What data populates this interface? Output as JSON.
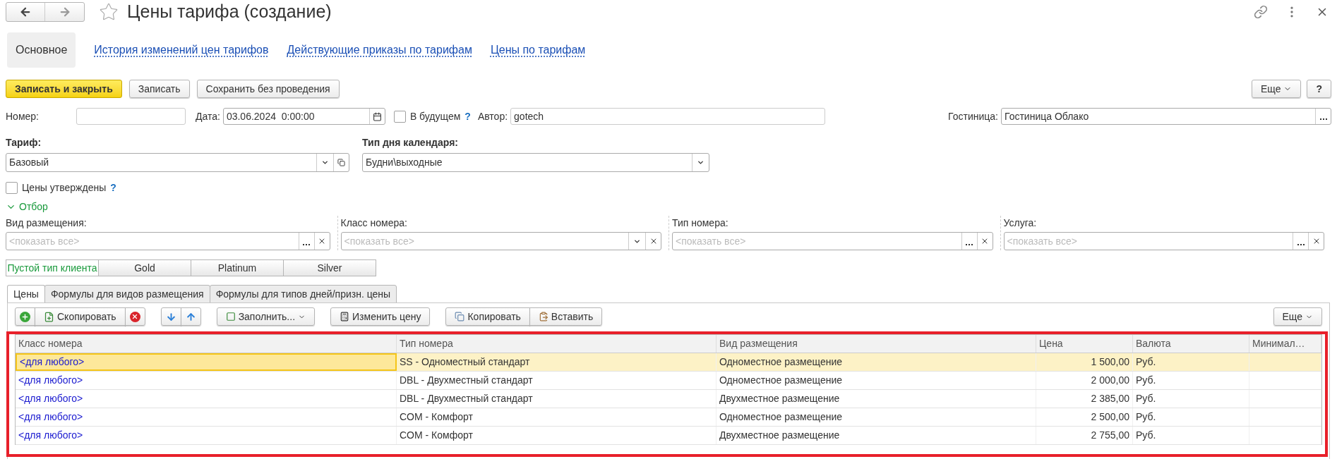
{
  "window": {
    "title": "Цены тарифа (создание)"
  },
  "nav_tabs": [
    {
      "label": "Основное",
      "selected": true
    },
    {
      "label": "История изменений цен тарифов",
      "selected": false
    },
    {
      "label": "Действующие приказы по тарифам",
      "selected": false
    },
    {
      "label": "Цены по тарифам",
      "selected": false
    }
  ],
  "command_bar": {
    "buttons": [
      {
        "label": "Записать и закрыть",
        "kind": "primary"
      },
      {
        "label": "Записать",
        "kind": "default"
      },
      {
        "label": "Сохранить без проведения",
        "kind": "default"
      }
    ],
    "more": "Еще",
    "help": "?"
  },
  "number": {
    "label": "Номер:"
  },
  "date": {
    "label": "Дата:",
    "value": "03.06.2024  0:00:00"
  },
  "in_future": {
    "label": "В будущем",
    "checked": false,
    "help": "?"
  },
  "author": {
    "label": "Автор:",
    "value": "gotech"
  },
  "hotel": {
    "label": "Гостиница:",
    "value": "Гостиница Облако"
  },
  "tariff": {
    "label": "Тариф:",
    "value": "Базовый"
  },
  "calendar_day_type": {
    "label": "Тип дня календаря:",
    "value": "Будни\\выходные"
  },
  "prices_approved": {
    "label": "Цены утверждены",
    "checked": false,
    "help": "?"
  },
  "filter": {
    "label": "Отбор",
    "expanded": true,
    "fields": [
      {
        "label": "Вид размещения:",
        "placeholder": "<показать все>",
        "kind": "picker"
      },
      {
        "label": "Класс номера:",
        "placeholder": "<показать все>",
        "kind": "dropdown"
      },
      {
        "label": "Тип номера:",
        "placeholder": "<показать все>",
        "kind": "picker"
      },
      {
        "label": "Услуга:",
        "placeholder": "<показать все>",
        "kind": "picker"
      }
    ]
  },
  "client_types": [
    {
      "label": "Пустой тип клиента",
      "selected": true
    },
    {
      "label": "Gold",
      "selected": false
    },
    {
      "label": "Platinum",
      "selected": false
    },
    {
      "label": "Silver",
      "selected": false
    }
  ],
  "inner_tabs": [
    {
      "label": "Цены",
      "selected": true
    },
    {
      "label": "Формулы для видов размещения",
      "selected": false
    },
    {
      "label": "Формулы для типов дней/призн. цены",
      "selected": false
    }
  ],
  "table_toolbar": {
    "copy_row": "Скопировать",
    "fill": "Заполнить...",
    "change_price": "Изменить цену",
    "copy": "Копировать",
    "paste": "Вставить",
    "more": "Еще"
  },
  "table": {
    "columns": [
      "Класс номера",
      "Тип номера",
      "Вид размещения",
      "Цена",
      "Валюта",
      "Минимал…"
    ],
    "rows": [
      {
        "selected": true,
        "cells": [
          "<для любого>",
          "SS - Одноместный стандарт",
          "Одноместное размещение",
          "1 500,00",
          "Руб."
        ]
      },
      {
        "selected": false,
        "cells": [
          "<для любого>",
          "DBL - Двухместный стандарт",
          "Одноместное размещение",
          "2 000,00",
          "Руб."
        ]
      },
      {
        "selected": false,
        "cells": [
          "<для любого>",
          "DBL - Двухместный стандарт",
          "Двухместное размещение",
          "2 385,00",
          "Руб."
        ]
      },
      {
        "selected": false,
        "cells": [
          "<для любого>",
          "COM - Комфорт",
          "Одноместное размещение",
          "2 500,00",
          "Руб."
        ]
      },
      {
        "selected": false,
        "cells": [
          "<для любого>",
          "COM - Комфорт",
          "Двухместное размещение",
          "2 755,00",
          "Руб."
        ]
      }
    ]
  }
}
